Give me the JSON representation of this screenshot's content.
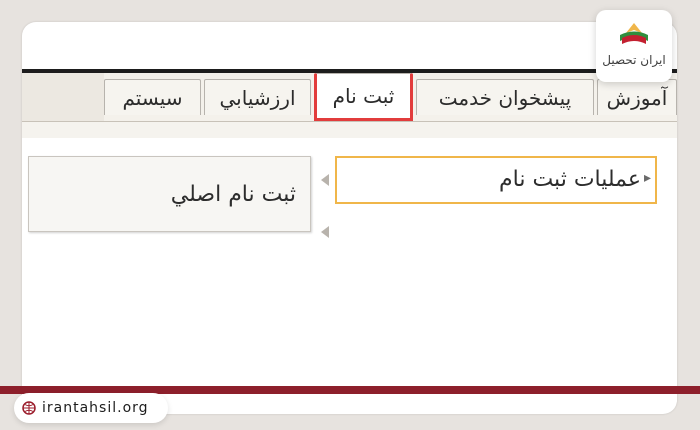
{
  "tabs": [
    {
      "label": "سيستم"
    },
    {
      "label": "ارزشيابي"
    },
    {
      "label": "ثبت نام",
      "active": true
    },
    {
      "label": "پيشخوان خدمت"
    },
    {
      "label": "آموزش"
    }
  ],
  "menu": {
    "primary": "عمليات ثبت نام",
    "secondary": "ثبت نام اصلي"
  },
  "brand": {
    "logo_text": "ایران تحصیل",
    "website": "irantahsil.org"
  },
  "colors": {
    "active_tab_border": "#e23c3c",
    "selected_item_border": "#f0b64a",
    "footer_bar": "#8d1f2b"
  },
  "icons": {
    "logo": "books-logo-icon",
    "globe": "globe-icon",
    "cursor": "cursor-icon",
    "arrow": "arrow-left-icon"
  }
}
